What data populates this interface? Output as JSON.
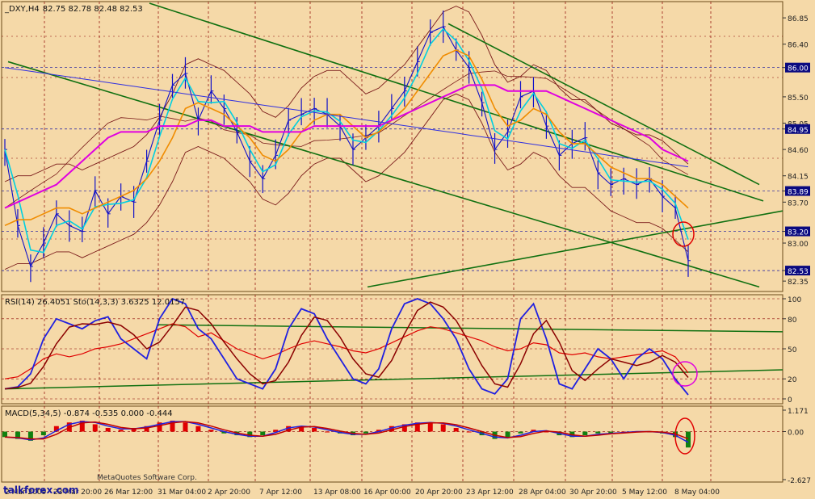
{
  "colors": {
    "background": "#F5D9A8",
    "grid": "#8B0000",
    "axis_box": "#6B4A1A",
    "price_bar": "#1010C8",
    "cyan_ma": "#00D0E0",
    "orange_ma": "#F08C00",
    "magenta_ma": "#E000E0",
    "blue_ma": "#3030E0",
    "bands": "#7A1A1A",
    "trend": "#107010",
    "rsi": "#E00000",
    "stoch_main": "#2020E0",
    "stoch_signal": "#8B0000",
    "macd_pos": "#E00000",
    "macd_neg": "#108010",
    "macd_line": "#2020E0",
    "signal_line": "#C00000"
  },
  "chart_data": [
    {
      "type": "line",
      "title": "_DXY,H4",
      "ohlc_label": "82.75 82.78 82.48 82.53",
      "ylim": [
        82.2,
        87.1
      ],
      "y_ticks": [
        "86.85",
        "86.40",
        "86.00",
        "85.50",
        "85.05",
        "84.95",
        "84.60",
        "84.15",
        "83.89",
        "83.70",
        "83.20",
        "83.00",
        "82.53",
        "82.35"
      ],
      "highlighted_levels": [
        86.0,
        84.95,
        83.89,
        83.2,
        82.53
      ],
      "x_tick_labels": [
        "2 Mar 2009",
        "23 Mar 20:00",
        "26 Mar 12:00",
        "31 Mar 04:00",
        "2 Apr 20:00",
        "7 Apr 12:00",
        "13 Apr 08:00",
        "16 Apr 00:00",
        "20 Apr 20:00",
        "23 Apr 12:00",
        "28 Apr 04:00",
        "30 Apr 20:00",
        "5 May 12:00",
        "8 May 04:00"
      ],
      "series": [
        {
          "values": [
            84.6,
            83.3,
            82.6,
            83.0,
            83.5,
            83.3,
            83.2,
            83.9,
            83.5,
            83.8,
            83.7,
            84.4,
            85.1,
            85.7,
            85.9,
            85.1,
            85.6,
            85.3,
            84.9,
            84.4,
            84.1,
            84.5,
            85.1,
            85.2,
            85.3,
            85.2,
            85.0,
            84.6,
            84.8,
            85.0,
            85.3,
            85.6,
            86.1,
            86.6,
            86.7,
            86.3,
            86.0,
            85.4,
            84.6,
            84.9,
            85.5,
            85.6,
            85.0,
            84.5,
            84.7,
            84.8,
            84.2,
            84.0,
            84.1,
            84.0,
            84.1,
            83.8,
            83.6,
            82.7
          ]
        },
        {
          "values": [
            83.3,
            83.4,
            83.4,
            83.5,
            83.6,
            83.6,
            83.5,
            83.6,
            83.7,
            83.8,
            83.9,
            84.1,
            84.4,
            84.8,
            85.3,
            85.4,
            85.3,
            85.2,
            85.0,
            84.8,
            84.5,
            84.4,
            84.6,
            84.9,
            85.1,
            85.2,
            85.2,
            85.0,
            84.8,
            84.9,
            85.1,
            85.3,
            85.6,
            85.9,
            86.2,
            86.3,
            86.2,
            85.8,
            85.3,
            85.0,
            85.1,
            85.3,
            85.2,
            84.9,
            84.7,
            84.7,
            84.5,
            84.3,
            84.2,
            84.1,
            84.1,
            84.0,
            83.8,
            83.6
          ]
        },
        {
          "values": [
            83.6,
            83.7,
            83.8,
            83.9,
            84.0,
            84.2,
            84.4,
            84.6,
            84.8,
            84.9,
            84.9,
            84.9,
            85.0,
            85.0,
            85.0,
            85.1,
            85.1,
            85.0,
            85.0,
            85.0,
            84.9,
            84.9,
            84.9,
            84.9,
            85.0,
            85.0,
            85.0,
            85.0,
            85.0,
            85.0,
            85.1,
            85.2,
            85.3,
            85.4,
            85.5,
            85.6,
            85.7,
            85.7,
            85.7,
            85.6,
            85.6,
            85.6,
            85.6,
            85.5,
            85.4,
            85.3,
            85.2,
            85.1,
            85.0,
            84.9,
            84.8,
            84.6,
            84.5,
            84.4
          ]
        }
      ]
    },
    {
      "type": "line",
      "title": "RSI(14) 26.4051  Sto(14,3,3) 3.6325 12.0157",
      "ylim": [
        0,
        100
      ],
      "y_ticks": [
        "100",
        "80",
        "50",
        "20",
        "0"
      ],
      "series": [
        {
          "values": [
            20,
            22,
            30,
            40,
            45,
            42,
            45,
            50,
            52,
            55,
            60,
            65,
            70,
            75,
            72,
            62,
            66,
            58,
            50,
            45,
            40,
            44,
            50,
            55,
            58,
            55,
            52,
            48,
            46,
            50,
            56,
            62,
            68,
            72,
            70,
            66,
            62,
            58,
            52,
            48,
            50,
            56,
            54,
            46,
            44,
            46,
            42,
            40,
            42,
            44,
            46,
            48,
            42,
            26
          ]
        },
        {
          "values": [
            10,
            12,
            25,
            60,
            80,
            75,
            70,
            78,
            82,
            60,
            50,
            40,
            80,
            100,
            95,
            70,
            60,
            40,
            20,
            15,
            10,
            30,
            70,
            90,
            85,
            60,
            40,
            20,
            15,
            30,
            70,
            95,
            100,
            95,
            80,
            60,
            30,
            10,
            5,
            20,
            80,
            95,
            60,
            15,
            10,
            30,
            50,
            40,
            20,
            40,
            50,
            40,
            20,
            4
          ]
        }
      ]
    },
    {
      "type": "bar",
      "title": "MACD(5,34,5) -0.874 -0.535 0.000 -0.444",
      "ylim": [
        -2.627,
        1.171
      ],
      "y_ticks": [
        "1.171",
        "0.00",
        "-2.627"
      ],
      "series": [
        {
          "values": [
            -0.3,
            -0.4,
            -0.5,
            -0.2,
            0.3,
            0.5,
            0.6,
            0.4,
            0.2,
            0.1,
            0.2,
            0.3,
            0.5,
            0.6,
            0.5,
            0.3,
            0.1,
            -0.1,
            -0.2,
            -0.3,
            -0.2,
            0.1,
            0.3,
            0.3,
            0.2,
            0.0,
            -0.1,
            -0.2,
            -0.1,
            0.1,
            0.3,
            0.4,
            0.5,
            0.5,
            0.4,
            0.2,
            0.0,
            -0.2,
            -0.4,
            -0.3,
            -0.1,
            0.1,
            0.0,
            -0.2,
            -0.3,
            -0.2,
            -0.1,
            -0.1,
            0.0,
            0.0,
            0.0,
            -0.1,
            -0.3,
            -0.87
          ]
        }
      ]
    }
  ],
  "watermarks": {
    "copyright": "MetaQuotes Software Corp.",
    "site": "talkforex.com"
  }
}
